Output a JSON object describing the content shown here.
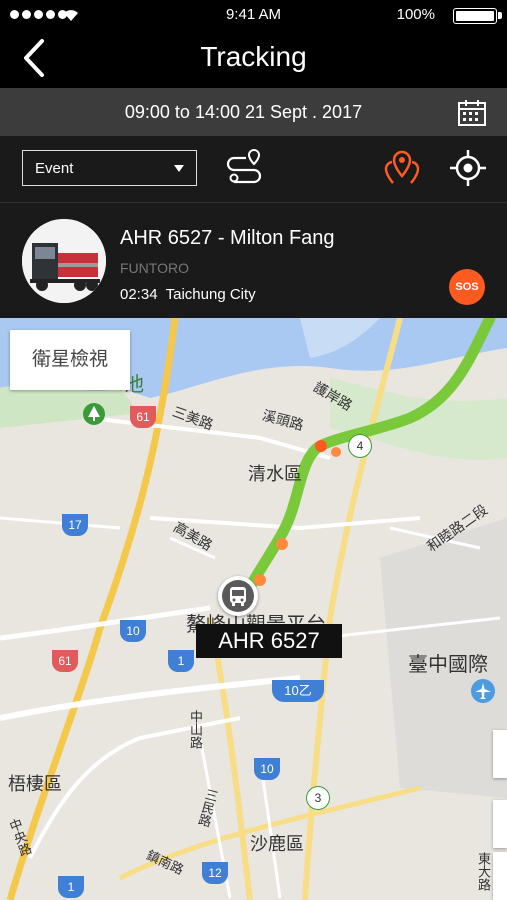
{
  "status_bar": {
    "time": "9:41 AM",
    "battery": "100%"
  },
  "nav": {
    "title": "Tracking",
    "back_icon": "chevron-left-icon"
  },
  "date_bar": {
    "range": "09:00 to 14:00  21 Sept . 2017",
    "calendar_icon": "calendar-icon"
  },
  "controls": {
    "filter_value": "Event",
    "route_icon": "route-icon",
    "multi_pin_icon": "multi-pin-icon",
    "locate_icon": "crosshair-icon",
    "accent": "#ff5a1f"
  },
  "vehicle": {
    "name": "AHR 6527 - Milton Fang",
    "company": "FUNTORO",
    "time": "02:34",
    "city": "Taichung City",
    "sos_label": "SOS"
  },
  "map": {
    "satellite_button": "衛星檢視",
    "plate_label": "AHR 6527",
    "route_color": "#7ac93b",
    "labels": {
      "l1": "清水區",
      "l2": "沙鹿區",
      "l3": "梧棲區",
      "l4": "臺中國際",
      "l5": "鰲峰山觀景平台",
      "l6": "三美路",
      "l7": "高美路",
      "l8": "溪頭路",
      "l9": "護岸路",
      "l10": "和睦路二段",
      "l11": "中山路",
      "l12": "三民路",
      "l13": "鎮南路",
      "l14": "中央路",
      "l15": "東大路",
      "l16": "池"
    },
    "shields": {
      "s61a": "61",
      "s61b": "61",
      "s17": "17",
      "s10a": "10",
      "s10b": "10",
      "s1a": "1",
      "s1b": "1",
      "s10yi": "10乙",
      "s12": "12",
      "s3": "3",
      "s4": "4"
    }
  }
}
